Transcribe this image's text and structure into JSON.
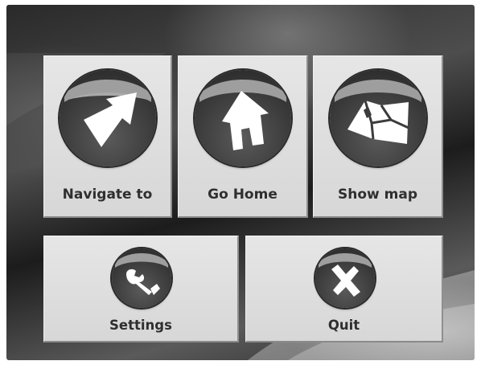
{
  "menu": {
    "navigate": {
      "label": "Navigate to",
      "icon": "arrow-icon"
    },
    "home": {
      "label": "Go Home",
      "icon": "house-icon"
    },
    "map": {
      "label": "Show map",
      "icon": "map-icon"
    },
    "settings": {
      "label": "Settings",
      "icon": "wrench-icon"
    },
    "quit": {
      "label": "Quit",
      "icon": "cross-icon"
    }
  },
  "colors": {
    "tile": "#dcdcdc",
    "label": "#2f2f2f",
    "orb": "#3c3c3c",
    "glyph": "#ffffff"
  }
}
